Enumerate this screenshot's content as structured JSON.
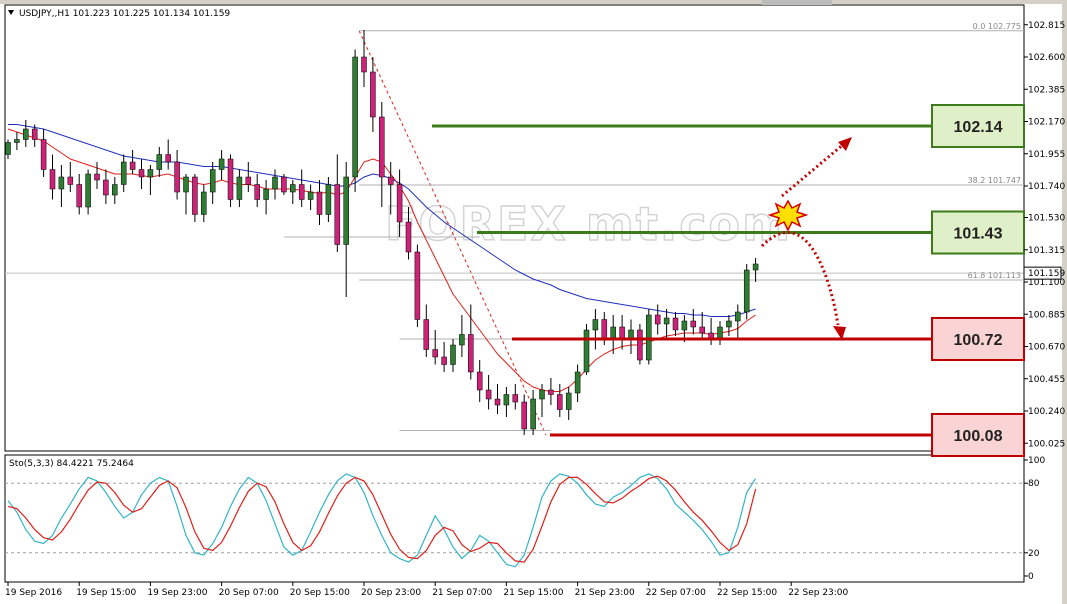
{
  "chart_header": {
    "dropdown_icon": "triangle-down-icon",
    "symbol_info": "USDJPY,,H1  101.223 101.225 101.134 101.159"
  },
  "stoch_header": "Sto(5,3,3) 84.4221 75.2464",
  "watermark": "FOREX mt.com",
  "colors": {
    "bull_candle": "#2e7d32",
    "bear_candle": "#cc2277",
    "ma_fast": "#e0201a",
    "ma_slow": "#2030c0",
    "support": "#c00000",
    "resistance": "#3c7a1a",
    "stoch_main": "#34b4c8",
    "stoch_signal": "#e0201a",
    "arrow": "#c00000",
    "star": "#ffe000"
  },
  "chart_data": {
    "type": "candlestick",
    "symbol": "USDJPY",
    "timeframe": "H1",
    "price_axis": {
      "ylim": [
        100.0,
        102.84
      ],
      "ticks": [
        "102.815",
        "102.600",
        "102.385",
        "102.170",
        "101.955",
        "101.740",
        "101.530",
        "101.315",
        "101.100",
        "100.885",
        "100.670",
        "100.455",
        "100.240",
        "100.025"
      ],
      "current_price": "101.159"
    },
    "time_axis": {
      "ticks": [
        "19 Sep 2016",
        "19 Sep 15:00",
        "19 Sep 23:00",
        "20 Sep 07:00",
        "20 Sep 15:00",
        "20 Sep 23:00",
        "21 Sep 07:00",
        "21 Sep 15:00",
        "21 Sep 23:00",
        "22 Sep 07:00",
        "22 Sep 15:00",
        "22 Sep 23:00"
      ],
      "bars_between_ticks": 8
    },
    "candles": [
      [
        101.95,
        102.05,
        101.92,
        102.03
      ],
      [
        102.03,
        102.1,
        101.98,
        102.05
      ],
      [
        102.05,
        102.18,
        102.0,
        102.12
      ],
      [
        102.12,
        102.15,
        102.0,
        102.05
      ],
      [
        102.05,
        102.12,
        101.8,
        101.85
      ],
      [
        101.85,
        101.95,
        101.65,
        101.72
      ],
      [
        101.72,
        101.88,
        101.6,
        101.8
      ],
      [
        101.8,
        101.9,
        101.7,
        101.75
      ],
      [
        101.75,
        101.82,
        101.55,
        101.6
      ],
      [
        101.6,
        101.85,
        101.55,
        101.82
      ],
      [
        101.82,
        101.9,
        101.72,
        101.78
      ],
      [
        101.78,
        101.85,
        101.62,
        101.68
      ],
      [
        101.68,
        101.8,
        101.62,
        101.75
      ],
      [
        101.75,
        101.95,
        101.7,
        101.9
      ],
      [
        101.9,
        101.98,
        101.82,
        101.85
      ],
      [
        101.85,
        101.92,
        101.72,
        101.8
      ],
      [
        101.8,
        101.88,
        101.68,
        101.85
      ],
      [
        101.85,
        102.0,
        101.8,
        101.95
      ],
      [
        101.95,
        102.05,
        101.85,
        101.9
      ],
      [
        101.9,
        101.98,
        101.65,
        101.7
      ],
      [
        101.7,
        101.82,
        101.55,
        101.8
      ],
      [
        101.8,
        101.82,
        101.5,
        101.55
      ],
      [
        101.55,
        101.75,
        101.5,
        101.7
      ],
      [
        101.7,
        101.9,
        101.62,
        101.85
      ],
      [
        101.85,
        101.98,
        101.78,
        101.92
      ],
      [
        101.92,
        101.95,
        101.6,
        101.65
      ],
      [
        101.65,
        101.85,
        101.6,
        101.8
      ],
      [
        101.8,
        101.9,
        101.7,
        101.75
      ],
      [
        101.75,
        101.82,
        101.6,
        101.65
      ],
      [
        101.65,
        101.78,
        101.55,
        101.72
      ],
      [
        101.72,
        101.85,
        101.65,
        101.8
      ],
      [
        101.8,
        101.82,
        101.68,
        101.7
      ],
      [
        101.7,
        101.78,
        101.62,
        101.75
      ],
      [
        101.75,
        101.85,
        101.6,
        101.65
      ],
      [
        101.65,
        101.75,
        101.58,
        101.7
      ],
      [
        101.7,
        101.78,
        101.48,
        101.55
      ],
      [
        101.55,
        101.8,
        101.5,
        101.75
      ],
      [
        101.75,
        101.95,
        101.3,
        101.35
      ],
      [
        101.35,
        101.9,
        101.0,
        101.8
      ],
      [
        101.8,
        102.65,
        101.7,
        102.6
      ],
      [
        102.6,
        102.78,
        102.4,
        102.5
      ],
      [
        102.5,
        102.6,
        102.1,
        102.2
      ],
      [
        102.2,
        102.3,
        101.6,
        101.8
      ],
      [
        101.8,
        101.9,
        101.55,
        101.75
      ],
      [
        101.75,
        101.85,
        101.4,
        101.5
      ],
      [
        101.5,
        101.6,
        101.25,
        101.3
      ],
      [
        101.3,
        101.35,
        100.8,
        100.85
      ],
      [
        100.85,
        100.95,
        100.6,
        100.65
      ],
      [
        100.65,
        100.78,
        100.55,
        100.6
      ],
      [
        100.6,
        100.7,
        100.5,
        100.55
      ],
      [
        100.55,
        100.72,
        100.5,
        100.68
      ],
      [
        100.68,
        100.88,
        100.6,
        100.75
      ],
      [
        100.75,
        100.95,
        100.45,
        100.5
      ],
      [
        100.5,
        100.58,
        100.3,
        100.38
      ],
      [
        100.38,
        100.48,
        100.25,
        100.32
      ],
      [
        100.32,
        100.42,
        100.22,
        100.28
      ],
      [
        100.28,
        100.4,
        100.2,
        100.35
      ],
      [
        100.35,
        100.42,
        100.25,
        100.3
      ],
      [
        100.3,
        100.35,
        100.08,
        100.12
      ],
      [
        100.12,
        100.38,
        100.08,
        100.32
      ],
      [
        100.32,
        100.42,
        100.2,
        100.38
      ],
      [
        100.38,
        100.46,
        100.28,
        100.35
      ],
      [
        100.35,
        100.42,
        100.2,
        100.25
      ],
      [
        100.25,
        100.4,
        100.18,
        100.36
      ],
      [
        100.36,
        100.55,
        100.3,
        100.5
      ],
      [
        100.5,
        100.82,
        100.48,
        100.78
      ],
      [
        100.78,
        100.92,
        100.65,
        100.85
      ],
      [
        100.85,
        100.9,
        100.68,
        100.72
      ],
      [
        100.72,
        100.88,
        100.62,
        100.8
      ],
      [
        100.8,
        100.88,
        100.65,
        100.72
      ],
      [
        100.72,
        100.85,
        100.62,
        100.78
      ],
      [
        100.78,
        100.82,
        100.55,
        100.58
      ],
      [
        100.58,
        100.92,
        100.55,
        100.88
      ],
      [
        100.88,
        100.95,
        100.75,
        100.82
      ],
      [
        100.82,
        100.92,
        100.72,
        100.86
      ],
      [
        100.86,
        100.9,
        100.74,
        100.78
      ],
      [
        100.78,
        100.88,
        100.7,
        100.84
      ],
      [
        100.84,
        100.92,
        100.75,
        100.8
      ],
      [
        100.8,
        100.9,
        100.72,
        100.76
      ],
      [
        100.76,
        100.86,
        100.68,
        100.72
      ],
      [
        100.72,
        100.84,
        100.68,
        100.8
      ],
      [
        100.8,
        100.88,
        100.74,
        100.84
      ],
      [
        100.84,
        100.95,
        100.72,
        100.9
      ],
      [
        100.9,
        101.22,
        100.85,
        101.18
      ],
      [
        101.18,
        101.26,
        101.1,
        101.22
      ]
    ],
    "ma_fast_values": [
      102.12,
      102.1,
      102.08,
      102.06,
      102.04,
      102.0,
      101.96,
      101.92,
      101.9,
      101.88,
      101.86,
      101.84,
      101.82,
      101.82,
      101.82,
      101.81,
      101.8,
      101.81,
      101.82,
      101.8,
      101.78,
      101.76,
      101.75,
      101.76,
      101.78,
      101.76,
      101.75,
      101.75,
      101.74,
      101.72,
      101.72,
      101.72,
      101.72,
      101.71,
      101.7,
      101.69,
      101.7,
      101.68,
      101.7,
      101.8,
      101.9,
      101.92,
      101.9,
      101.82,
      101.74,
      101.64,
      101.5,
      101.38,
      101.26,
      101.14,
      101.02,
      100.94,
      100.86,
      100.78,
      100.7,
      100.62,
      100.56,
      100.5,
      100.44,
      100.4,
      100.38,
      100.37,
      100.37,
      100.4,
      100.45,
      100.52,
      100.58,
      100.62,
      100.65,
      100.67,
      100.68,
      100.68,
      100.7,
      100.72,
      100.74,
      100.75,
      100.76,
      100.76,
      100.76,
      100.75,
      100.76,
      100.77,
      100.79,
      100.84,
      100.88
    ],
    "ma_slow_values": [
      102.15,
      102.15,
      102.14,
      102.13,
      102.12,
      102.1,
      102.08,
      102.06,
      102.04,
      102.02,
      102.0,
      101.98,
      101.96,
      101.94,
      101.93,
      101.92,
      101.91,
      101.9,
      101.9,
      101.9,
      101.89,
      101.88,
      101.87,
      101.87,
      101.87,
      101.86,
      101.85,
      101.84,
      101.83,
      101.82,
      101.81,
      101.8,
      101.79,
      101.78,
      101.77,
      101.76,
      101.75,
      101.74,
      101.74,
      101.76,
      101.8,
      101.82,
      101.81,
      101.79,
      101.76,
      101.72,
      101.66,
      101.6,
      101.55,
      101.5,
      101.46,
      101.42,
      101.38,
      101.34,
      101.3,
      101.26,
      101.22,
      101.18,
      101.15,
      101.12,
      101.1,
      101.08,
      101.05,
      101.03,
      101.01,
      100.99,
      100.98,
      100.97,
      100.96,
      100.95,
      100.94,
      100.93,
      100.92,
      100.91,
      100.9,
      100.89,
      100.89,
      100.88,
      100.88,
      100.87,
      100.87,
      100.87,
      100.88,
      100.9,
      100.92
    ],
    "stoch_main": [
      65,
      55,
      40,
      30,
      28,
      35,
      50,
      62,
      75,
      85,
      82,
      72,
      60,
      50,
      55,
      70,
      80,
      85,
      82,
      60,
      35,
      20,
      18,
      28,
      42,
      60,
      75,
      85,
      80,
      65,
      45,
      25,
      18,
      22,
      38,
      55,
      70,
      82,
      88,
      85,
      72,
      52,
      35,
      20,
      15,
      12,
      18,
      35,
      52,
      40,
      25,
      15,
      22,
      35,
      30,
      20,
      10,
      8,
      18,
      42,
      68,
      82,
      88,
      86,
      80,
      70,
      62,
      60,
      68,
      72,
      78,
      85,
      88,
      84,
      75,
      62,
      55,
      48,
      40,
      30,
      18,
      20,
      42,
      72,
      84
    ],
    "stoch_signal": [
      60,
      58,
      50,
      40,
      33,
      31,
      38,
      49,
      62,
      74,
      81,
      80,
      72,
      61,
      55,
      58,
      68,
      78,
      82,
      76,
      59,
      38,
      24,
      22,
      29,
      43,
      59,
      73,
      80,
      77,
      64,
      45,
      29,
      22,
      26,
      38,
      54,
      69,
      80,
      85,
      82,
      70,
      53,
      36,
      23,
      16,
      15,
      22,
      35,
      42,
      39,
      27,
      21,
      24,
      29,
      28,
      20,
      13,
      12,
      23,
      43,
      64,
      79,
      85,
      85,
      79,
      71,
      64,
      63,
      67,
      73,
      78,
      84,
      86,
      82,
      74,
      64,
      55,
      48,
      39,
      29,
      22,
      27,
      45,
      75
    ],
    "stoch_axis": {
      "ylim": [
        0,
        100
      ],
      "ticks": [
        "100",
        "80",
        "20",
        "0"
      ]
    },
    "levels": [
      {
        "price": 102.14,
        "label": "102.14",
        "kind": "resistance"
      },
      {
        "price": 101.43,
        "label": "101.43",
        "kind": "resistance"
      },
      {
        "price": 100.72,
        "label": "100.72",
        "kind": "support"
      },
      {
        "price": 100.08,
        "label": "100.08",
        "kind": "support"
      }
    ],
    "fibonacci": {
      "high": 102.775,
      "low": 100.08,
      "labels": [
        {
          "text": "0.0  102.775",
          "price": 102.775
        },
        {
          "text": "38.2  101.747",
          "price": 101.747
        },
        {
          "text": "61.8  101.113",
          "price": 101.113
        }
      ]
    },
    "grid": false
  }
}
